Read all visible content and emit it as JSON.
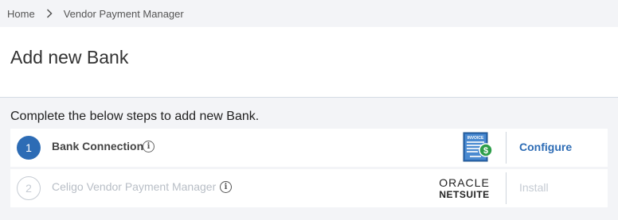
{
  "breadcrumb": {
    "home": "Home",
    "current": "Vendor Payment Manager"
  },
  "page": {
    "title": "Add new Bank",
    "instructions": "Complete the below steps to add new Bank."
  },
  "steps": [
    {
      "number": "1",
      "label": "Bank Connection",
      "info_icon": "i",
      "logo": "invoice-icon",
      "logo_text": "INVOICE",
      "action": "Configure",
      "state": "active"
    },
    {
      "number": "2",
      "label": "Celigo Vendor Payment Manager",
      "info_icon": "i",
      "logo": "oracle-netsuite-logo",
      "logo_line1": "ORACLE",
      "logo_line2": "NETSUITE",
      "action": "Install",
      "state": "disabled"
    }
  ],
  "colors": {
    "accent": "#2d6cb5",
    "disabled": "#c5cbd3",
    "background": "#f3f4f7"
  }
}
